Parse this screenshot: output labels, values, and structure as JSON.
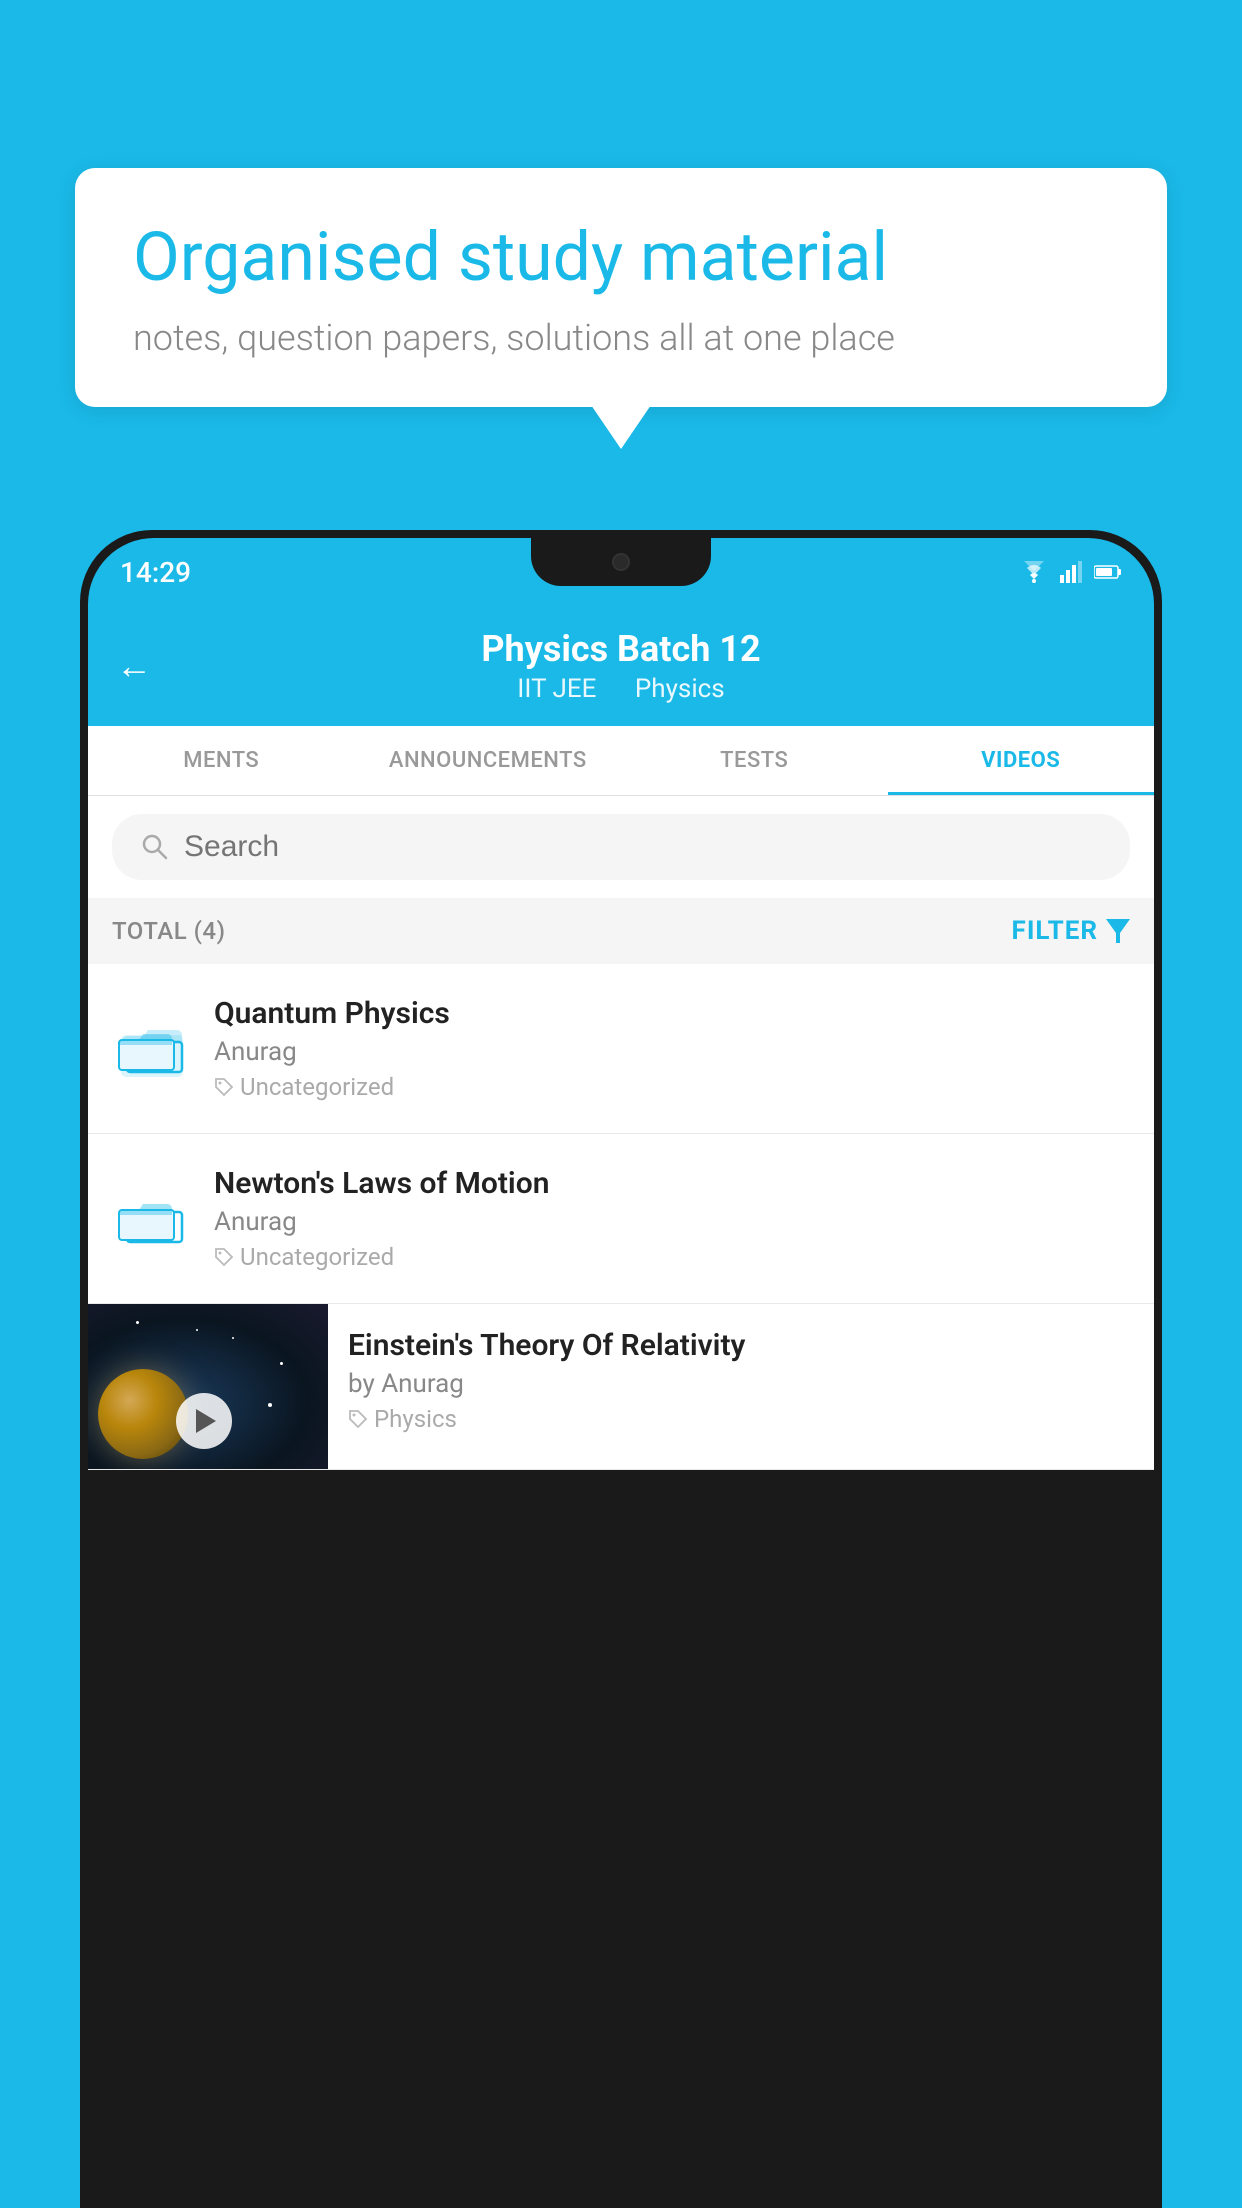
{
  "speechBubble": {
    "title": "Organised study material",
    "subtitle": "notes, question papers, solutions all at one place"
  },
  "statusBar": {
    "time": "14:29"
  },
  "appHeader": {
    "title": "Physics Batch 12",
    "subtitle1": "IIT JEE",
    "subtitle2": "Physics",
    "backLabel": "←"
  },
  "tabs": [
    {
      "label": "MENTS",
      "active": false
    },
    {
      "label": "ANNOUNCEMENTS",
      "active": false
    },
    {
      "label": "TESTS",
      "active": false
    },
    {
      "label": "VIDEOS",
      "active": true
    }
  ],
  "search": {
    "placeholder": "Search"
  },
  "filterBar": {
    "total": "TOTAL (4)",
    "filterLabel": "FILTER"
  },
  "videos": [
    {
      "title": "Quantum Physics",
      "author": "Anurag",
      "tag": "Uncategorized",
      "hasThumb": false
    },
    {
      "title": "Newton's Laws of Motion",
      "author": "Anurag",
      "tag": "Uncategorized",
      "hasThumb": false
    },
    {
      "title": "Einstein's Theory Of Relativity",
      "author": "by Anurag",
      "tag": "Physics",
      "hasThumb": true
    }
  ]
}
